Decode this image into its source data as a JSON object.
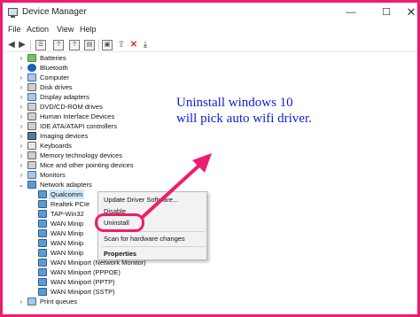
{
  "window": {
    "title": "Device Manager",
    "controls": {
      "minimize": "—",
      "maximize": "☐",
      "close": "✕"
    }
  },
  "menu": [
    "File",
    "Action",
    "View",
    "Help"
  ],
  "toolbar": {
    "icons": [
      "back-arrow-icon",
      "forward-arrow-icon",
      "properties-icon",
      "help-icon",
      "help-box-icon",
      "display-icon",
      "update-driver-icon",
      "uninstall-icon",
      "download-icon"
    ]
  },
  "tree": {
    "items": [
      {
        "label": "Batteries",
        "expanded": false,
        "icon": "battery-icon"
      },
      {
        "label": "Bluetooth",
        "expanded": false,
        "icon": "bluetooth-icon"
      },
      {
        "label": "Computer",
        "expanded": false,
        "icon": "computer-icon"
      },
      {
        "label": "Disk drives",
        "expanded": false,
        "icon": "disk-icon"
      },
      {
        "label": "Display adapters",
        "expanded": false,
        "icon": "display-icon"
      },
      {
        "label": "DVD/CD-ROM drives",
        "expanded": false,
        "icon": "dvd-icon"
      },
      {
        "label": "Human Interface Devices",
        "expanded": false,
        "icon": "hid-icon"
      },
      {
        "label": "IDE ATA/ATAPI controllers",
        "expanded": false,
        "icon": "ide-icon"
      },
      {
        "label": "Imaging devices",
        "expanded": false,
        "icon": "camera-icon"
      },
      {
        "label": "Keyboards",
        "expanded": false,
        "icon": "keyboard-icon"
      },
      {
        "label": "Memory technology devices",
        "expanded": false,
        "icon": "memory-icon"
      },
      {
        "label": "Mice and other pointing devices",
        "expanded": false,
        "icon": "mouse-icon"
      },
      {
        "label": "Monitors",
        "expanded": false,
        "icon": "monitor-icon"
      },
      {
        "label": "Network adapters",
        "expanded": true,
        "icon": "network-icon"
      }
    ],
    "network_children": [
      "Qualcomm",
      "Realtek PCIe",
      "TAP-Win32",
      "WAN Minip",
      "WAN Minip",
      "WAN Minip",
      "WAN Minip",
      "WAN Miniport (Network Monitor)",
      "WAN Miniport (PPPOE)",
      "WAN Miniport (PPTP)",
      "WAN Miniport (SSTP)"
    ],
    "after": {
      "label": "Print queues",
      "expanded": false
    }
  },
  "context_menu": {
    "update_driver": "Update Driver Software...",
    "disable": "Disable",
    "uninstall": "Uninstall",
    "scan": "Scan for hardware changes",
    "properties": "Properties"
  },
  "annotation": {
    "line1": "Uninstall windows 10",
    "line2": "will pick auto wifi driver.",
    "color": "#0a1fd6",
    "highlight_color": "#ee1c6e"
  }
}
